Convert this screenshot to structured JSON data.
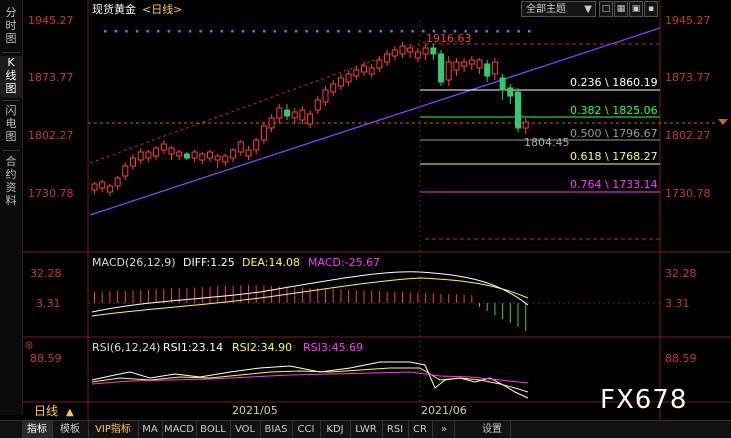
{
  "sidebar": {
    "tabs": [
      {
        "label": "分时图"
      },
      {
        "label": "K线图"
      },
      {
        "label": "闪电图"
      },
      {
        "label": "合约资料"
      }
    ]
  },
  "header": {
    "title": "现货黄金",
    "period_link": "<日线>",
    "theme_label": "全部主题",
    "theme_caret": "▼"
  },
  "price_axis": {
    "left": [
      "1945.27",
      "1873.77",
      "1802.27",
      "1730.78"
    ],
    "right": [
      "1945.27",
      "1873.77",
      "1802.27",
      "1730.78"
    ]
  },
  "annotations": {
    "high": "1916.63",
    "low": "1804.45"
  },
  "fib_levels": [
    {
      "text": "0.236 \\ 1860.19",
      "color": "#ffffff"
    },
    {
      "text": "0.382 \\ 1825.06",
      "color": "#33ff33"
    },
    {
      "text": "0.500 \\ 1796.67",
      "color": "#999999"
    },
    {
      "text": "0.618 \\ 1768.27",
      "color": "#ffff33"
    },
    {
      "text": "0.764 \\ 1733.14",
      "color": "#ff33ff"
    }
  ],
  "macd": {
    "label": "MACD(26,12,9)",
    "diff": "DIFF:1.25",
    "dea": "DEA:14.08",
    "macd": "MACD:-25.67",
    "axis_left": [
      "32.28",
      "3.31"
    ],
    "axis_right": [
      "32.28",
      "3.31"
    ]
  },
  "rsi": {
    "label": "RSI(6,12,24)",
    "rsi1": "RSI1:23.14",
    "rsi2": "RSI2:34.90",
    "rsi3": "RSI3:45.69",
    "axis_left": "88.59",
    "axis_right": "88.59"
  },
  "time_axis": [
    "2021/05",
    "2021/06"
  ],
  "period_label": "日线",
  "period_caret": "▲",
  "bottom_tabs": [
    {
      "label": "指标",
      "vip": false
    },
    {
      "label": "模板",
      "vip": false
    },
    {
      "label": "VIP指标",
      "vip": true
    },
    {
      "label": "MA",
      "vip": false
    },
    {
      "label": "MACD",
      "vip": false
    },
    {
      "label": "BOLL",
      "vip": false
    },
    {
      "label": "VOL",
      "vip": false
    },
    {
      "label": "BIAS",
      "vip": false
    },
    {
      "label": "CCI",
      "vip": false
    },
    {
      "label": "KDJ",
      "vip": false
    },
    {
      "label": "LWR",
      "vip": false
    },
    {
      "label": "RSI",
      "vip": false
    },
    {
      "label": "CR",
      "vip": false
    },
    {
      "label": "»",
      "vip": false
    },
    {
      "label": "设置",
      "vip": false
    }
  ],
  "watermark": "FX678",
  "colors": {
    "up": "#ff3b3b",
    "down": "#2ecc71",
    "trend": "#7a44ff",
    "dashed_red": "#cc2222",
    "dots": "#2a8cff"
  }
}
